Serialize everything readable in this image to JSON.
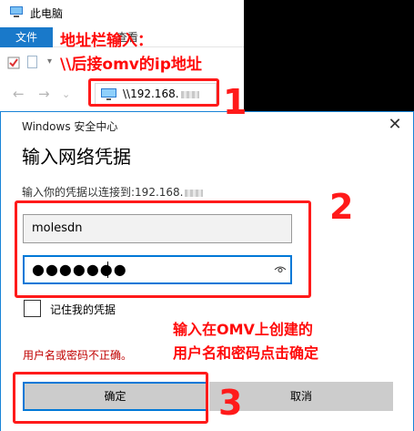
{
  "explorer": {
    "title": "此电脑",
    "file_tab": "文件",
    "view_tab": "查看",
    "address": "\\\\192.168."
  },
  "dialog": {
    "caption": "Windows 安全中心",
    "heading": "输入网络凭据",
    "prompt": "输入你的凭据以连接到:192.168.",
    "username": "molesdn",
    "password_mask": "●●●●●●●",
    "remember_label": "记住我的凭据",
    "error": "用户名或密码不正确。",
    "ok_label": "确定",
    "cancel_label": "取消",
    "close_glyph": "✕"
  },
  "annotations": {
    "note1_line1": "地址栏输入：",
    "note1_line2": "\\\\后接omv的ip地址",
    "note2_line1": "输入在OMV上创建的",
    "note2_line2": "用户名和密码点击确定",
    "step1": "1",
    "step2": "2",
    "step3": "3",
    "color": "#ff1a1a"
  },
  "colors": {
    "accent": "#0078d7",
    "file_tab": "#1979ca",
    "error": "#c00000"
  }
}
